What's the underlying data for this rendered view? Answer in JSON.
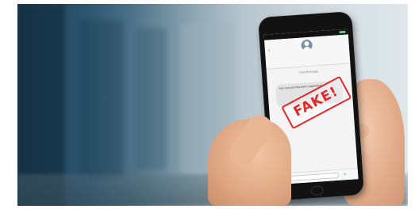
{
  "phone": {
    "status_bar": {
      "carrier": "",
      "time": ""
    },
    "conversation": {
      "sender_name": "",
      "sender_subtitle": "",
      "label": "Text Message",
      "timestamp": "",
      "message_text": "Your account has been suspended..."
    },
    "stamp_text": "FAKE!",
    "composer": {
      "placeholder": ""
    }
  },
  "colors": {
    "stamp": "#e02a2a",
    "send": "#4bd964",
    "link": "#3b7bd6"
  }
}
